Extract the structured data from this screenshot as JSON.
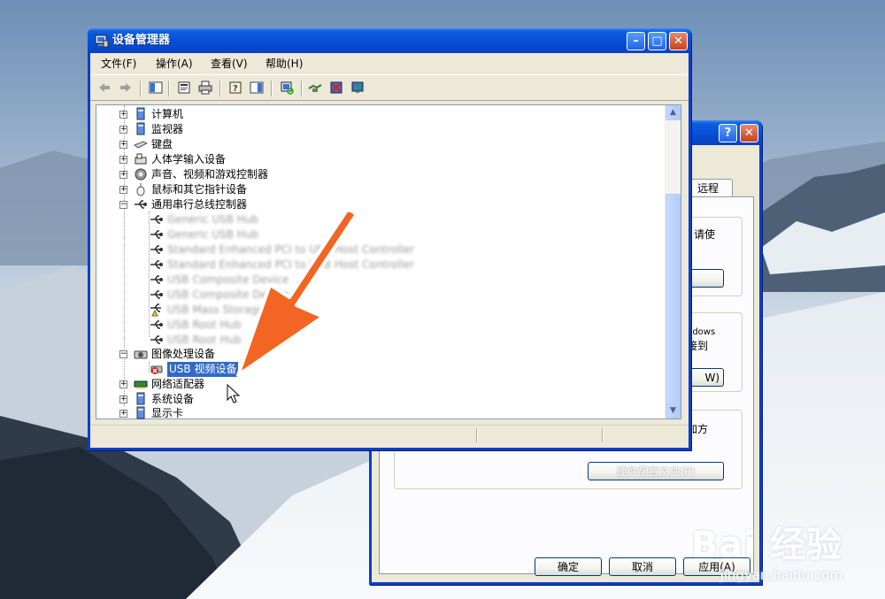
{
  "device_manager": {
    "title": "设备管理器",
    "menus": [
      "文件(F)",
      "操作(A)",
      "查看(V)",
      "帮助(H)"
    ],
    "tree": [
      {
        "label": "计算机",
        "expander": "+",
        "icon": "computer-icon"
      },
      {
        "label": "监视器",
        "expander": "+",
        "icon": "monitor-icon"
      },
      {
        "label": "键盘",
        "expander": "+",
        "icon": "keyboard-icon"
      },
      {
        "label": "人体学输入设备",
        "expander": "+",
        "icon": "hid-icon"
      },
      {
        "label": "声音、视频和游戏控制器",
        "expander": "+",
        "icon": "sound-icon"
      },
      {
        "label": "鼠标和其它指针设备",
        "expander": "+",
        "icon": "mouse-icon"
      },
      {
        "label": "通用串行总线控制器",
        "expander": "−",
        "icon": "usb-icon"
      }
    ],
    "usb_children": [
      "Generic USB Hub",
      "Generic USB Hub",
      "Standard Enhanced PCI to USB Host Controller",
      "Standard Enhanced PCI to USB Host Controller",
      "USB Composite Device",
      "USB Composite Device",
      "USB Mass Storage Device",
      "USB Root Hub",
      "USB Root Hub"
    ],
    "imaging": {
      "label": "图像处理设备",
      "expander": "−",
      "child": "USB 视频设备"
    },
    "tree_after": [
      {
        "label": "网络适配器",
        "expander": "+",
        "icon": "network-icon"
      },
      {
        "label": "系统设备",
        "expander": "+",
        "icon": "system-icon"
      },
      {
        "label": "显示卡",
        "expander": "+",
        "icon": "display-icon"
      }
    ]
  },
  "back_dialog": {
    "tab_label": "远程",
    "text1": "请使",
    "text2a": "ndows",
    "text2b": "接到",
    "btn_w": "W)",
    "text3": "加方",
    "btn_bottom": "硬件配置文件(P)",
    "ok": "确定",
    "cancel": "取消",
    "apply": "应用(A)"
  },
  "watermark": {
    "brand": "Bai 经验",
    "url": "jingyan.baidu.com"
  },
  "colors": {
    "title_blue": "#0850d6",
    "arrow_orange": "#f26522",
    "selection": "#316ac5"
  }
}
